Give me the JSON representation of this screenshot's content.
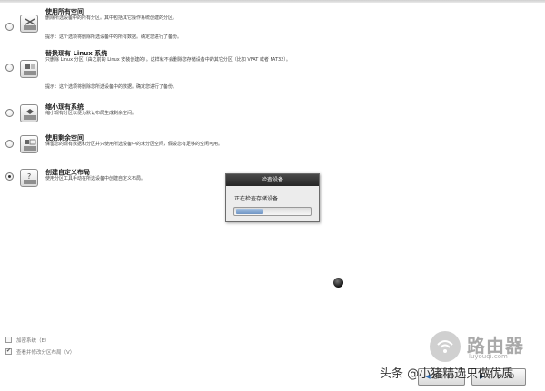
{
  "options": [
    {
      "title": "使用所有空间",
      "desc": "删除所选设备中的所有分区。其中包括其它操作系统创建的分区。",
      "note": "提示：这个选项将删除所选设备中的所有数据。确定您进行了备份。",
      "icon": "drive-erase-icon",
      "selected": false
    },
    {
      "title": "替换现有 Linux 系统",
      "desc": "只删除 Linux 分区（由之前的 Linux 安装创建的）。这样就不会删除您存储设备中的其它分区（比如 VFAT 或者 FAT32）。",
      "note": "提示：这个选项将删除您所选设备中的数据。确定您进行了备份。",
      "icon": "drive-replace-icon",
      "selected": false
    },
    {
      "title": "缩小现有系统",
      "desc": "缩小现有分区以便为默认布局生成剩余空间。",
      "note": "",
      "icon": "drive-shrink-icon",
      "selected": false
    },
    {
      "title": "使用剩余空间",
      "desc": "保留您的现有数据和分区并只使用所选设备中的未分区空间，假设您有足够的空闲可用。",
      "note": "",
      "icon": "drive-free-space-icon",
      "selected": false
    },
    {
      "title": "创建自定义布局",
      "desc": "使用分区工具手动在所选设备中创建自定义布局。",
      "note": "",
      "icon": "drive-custom-icon",
      "selected": true
    }
  ],
  "dialog": {
    "title": "检查设备",
    "message": "正在检查存储设备",
    "progress": 0.35
  },
  "checkboxes": [
    {
      "label": "加密系统（E）",
      "checked": false
    },
    {
      "label": "查看并修改分区布局（V）",
      "checked": true
    }
  ],
  "buttons": {
    "back": "返回（B）",
    "next": "下一步（N）"
  },
  "watermark": {
    "credit": "头条 @小猪精选只做优质",
    "brand_cn": "路由器",
    "brand_en": "luyouqi.com"
  },
  "colors": {
    "progress_fill": "#7fa3cf",
    "dialog_titlebar": "#2f2f2f"
  }
}
